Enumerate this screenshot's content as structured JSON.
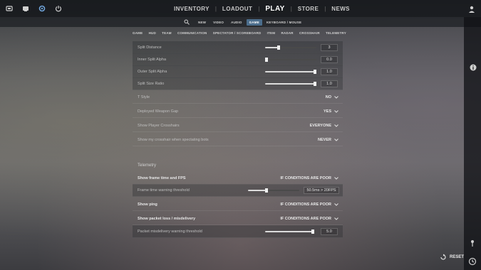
{
  "top_nav": {
    "items": [
      {
        "label": "INVENTORY"
      },
      {
        "label": "LOADOUT"
      },
      {
        "label": "PLAY"
      },
      {
        "label": "STORE"
      },
      {
        "label": "NEWS"
      }
    ],
    "active": "PLAY",
    "icons": [
      "home-icon",
      "tv-icon",
      "settings-icon",
      "power-icon",
      "profile-icon"
    ]
  },
  "sub_nav": {
    "tabs": [
      "NEW",
      "VIDEO",
      "AUDIO",
      "GAME",
      "KEYBOARD / MOUSE"
    ],
    "active": "GAME"
  },
  "categories": [
    "GAME",
    "HUD",
    "TEAM",
    "COMMUNICATION",
    "SPECTATOR / SCOREBOARD",
    "ITEM",
    "RADAR",
    "CROSSHAIR",
    "TELEMETRY"
  ],
  "settings": {
    "split_distance": {
      "label": "Split Distance",
      "value": "3",
      "fraction": 0.25
    },
    "inner_split_alpha": {
      "label": "Inner Split Alpha",
      "value": "0.0",
      "fraction": 0.0
    },
    "outer_split_alpha": {
      "label": "Outer Split Alpha",
      "value": "1.0",
      "fraction": 1.0
    },
    "split_size_ratio": {
      "label": "Split Size Ratio",
      "value": "1.0",
      "fraction": 1.0
    },
    "t_style": {
      "label": "T Style",
      "value": "NO"
    },
    "deployed_weapon_gap": {
      "label": "Deployed Weapon Gap",
      "value": "YES"
    },
    "show_player_crosshairs": {
      "label": "Show Player Crosshairs",
      "value": "EVERYONE"
    },
    "show_my_crosshair_bots": {
      "label": "Show my crosshair when spectating bots",
      "value": "NEVER"
    }
  },
  "telemetry": {
    "title": "Telemetry",
    "frame_time": {
      "label": "Show frame time and FPS",
      "value": "IF CONDITIONS ARE POOR"
    },
    "frame_time_threshold": {
      "label": "Frame time warning threshold",
      "value": "50.5ms > 20FPS",
      "fraction": 0.36
    },
    "show_ping": {
      "label": "Show ping",
      "value": "IF CONDITIONS ARE POOR"
    },
    "packet_loss": {
      "label": "Show packet loss / misdelivery",
      "value": "IF CONDITIONS ARE POOR"
    },
    "packet_threshold": {
      "label": "Packet misdelivery warning threshold",
      "value": "5.0",
      "fraction": 0.95
    }
  },
  "reset": {
    "label": "RESET"
  },
  "colors": {
    "active_tab": "#4b6d8c",
    "slider_fill": "#dcdcdc"
  }
}
